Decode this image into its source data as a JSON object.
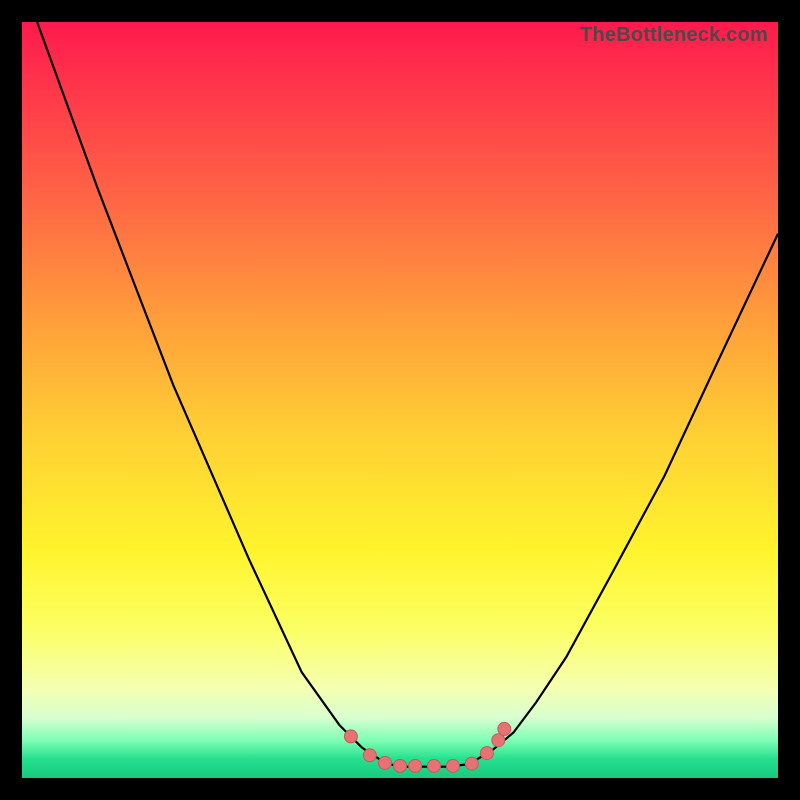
{
  "watermark": {
    "text": "TheBottleneck.com"
  },
  "chart_data": {
    "type": "line",
    "title": "",
    "xlabel": "",
    "ylabel": "",
    "xlim": [
      0,
      100
    ],
    "ylim": [
      0,
      100
    ],
    "series": [
      {
        "name": "curve",
        "x": [
          2,
          10,
          20,
          30,
          37,
          42,
          45,
          48,
          50,
          53,
          56,
          59,
          62,
          65,
          68,
          72,
          78,
          85,
          92,
          100
        ],
        "y": [
          100,
          78,
          52,
          29,
          14,
          7,
          4,
          2,
          1.5,
          1.5,
          1.5,
          1.8,
          3.5,
          6,
          10,
          16,
          27,
          40,
          55,
          72
        ]
      }
    ],
    "markers": {
      "name": "highlight-points",
      "x": [
        43.5,
        46,
        48,
        50,
        52,
        54.5,
        57,
        59.5,
        61.5,
        63,
        63.8
      ],
      "y": [
        5.5,
        3.0,
        2.0,
        1.6,
        1.6,
        1.6,
        1.6,
        1.9,
        3.3,
        5.0,
        6.5
      ]
    },
    "colors": {
      "curve": "#000000",
      "marker_fill": "#e57373",
      "marker_stroke": "#c75b5b",
      "gradient_top": "#ff1a4d",
      "gradient_bottom": "#18c97f"
    }
  }
}
